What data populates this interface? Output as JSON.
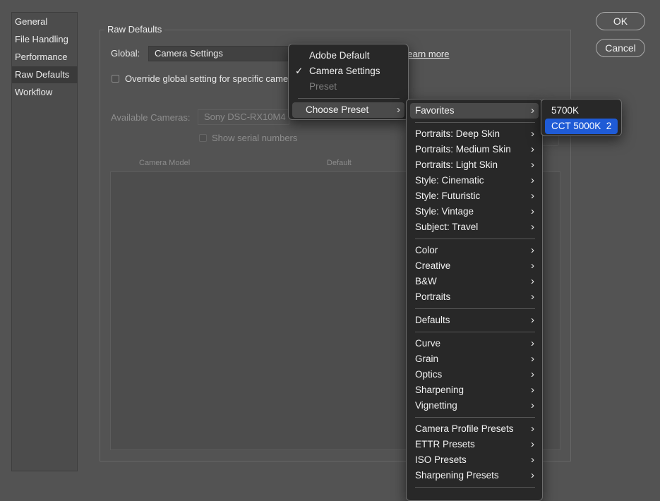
{
  "sidebar": {
    "items": [
      {
        "label": "General"
      },
      {
        "label": "File Handling"
      },
      {
        "label": "Performance"
      },
      {
        "label": "Raw Defaults"
      },
      {
        "label": "Workflow"
      }
    ]
  },
  "raw_defaults": {
    "group_title": "Raw Defaults",
    "global_label": "Global:",
    "global_value": "Camera Settings",
    "learn_more": "Learn more",
    "override_label": "Override global setting for specific camera",
    "available_cameras_label": "Available Cameras:",
    "available_cameras_value": "Sony DSC-RX10M4",
    "show_serial_label": "Show serial numbers",
    "col_camera_model": "Camera Model",
    "col_default": "Default"
  },
  "dialog": {
    "ok": "OK",
    "cancel": "Cancel"
  },
  "global_menu": {
    "items": [
      {
        "label": "Adobe Default",
        "check": ""
      },
      {
        "label": "Camera Settings",
        "check": "✓"
      },
      {
        "label": "Preset",
        "check": ""
      },
      {
        "label": "Choose Preset",
        "arrow": "›"
      }
    ]
  },
  "preset_menu": {
    "items": [
      "Favorites",
      "Portraits: Deep Skin",
      "Portraits: Medium Skin",
      "Portraits: Light Skin",
      "Style: Cinematic",
      "Style: Futuristic",
      "Style: Vintage",
      "Subject: Travel",
      "Color",
      "Creative",
      "B&W",
      "Portraits",
      "Defaults",
      "Curve",
      "Grain",
      "Optics",
      "Sharpening",
      "Vignetting",
      "Camera Profile Presets",
      "ETTR Presets",
      "ISO Presets",
      "Sharpening Presets"
    ],
    "arrow": "›"
  },
  "favorites_menu": {
    "items": [
      "5700K",
      "CCT 5000K  2"
    ]
  },
  "colors": {
    "background": "#535353",
    "menu_bg": "#282828",
    "selection": "#1f5bd6"
  },
  "icons": {
    "checkmark": "checkmark-icon",
    "submenu": "chevron-right-icon"
  }
}
